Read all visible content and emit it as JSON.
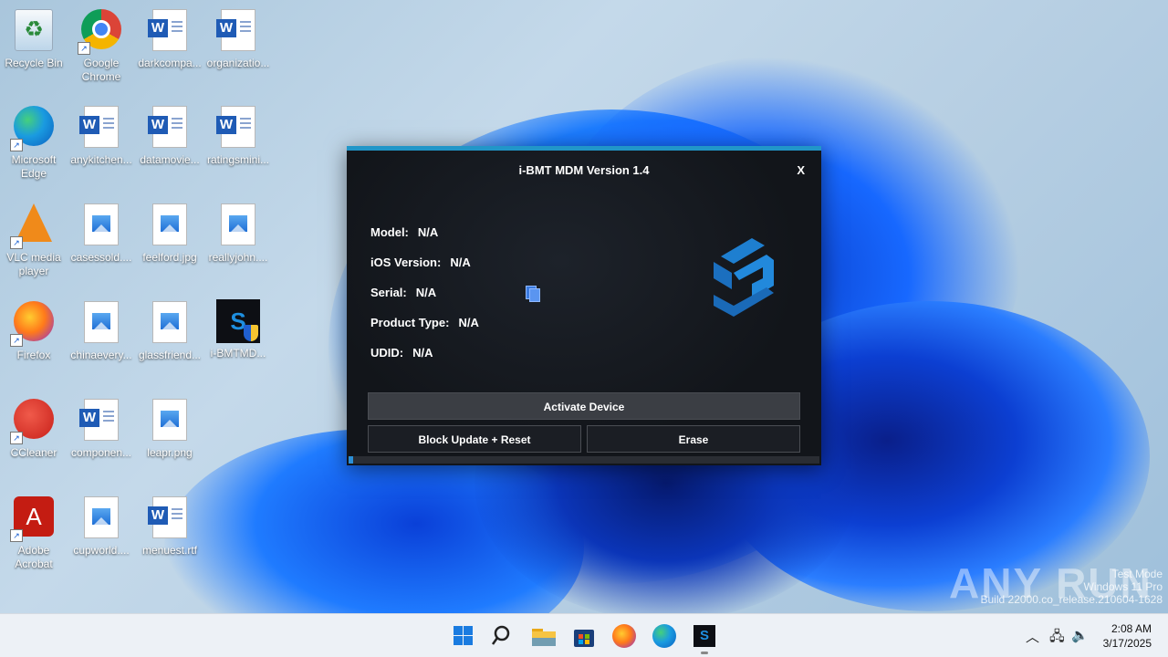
{
  "desktop": {
    "icons": [
      {
        "label": "Recycle Bin"
      },
      {
        "label": "Google Chrome"
      },
      {
        "label": "darkcompa..."
      },
      {
        "label": "organizatio..."
      },
      {
        "label": "Microsoft Edge"
      },
      {
        "label": "anykitchen..."
      },
      {
        "label": "datamovie..."
      },
      {
        "label": "ratingsmini..."
      },
      {
        "label": "VLC media player"
      },
      {
        "label": "casessold...."
      },
      {
        "label": "feelford.jpg"
      },
      {
        "label": "reallyjohn...."
      },
      {
        "label": "Firefox"
      },
      {
        "label": "chinaevery..."
      },
      {
        "label": "glassfriend..."
      },
      {
        "label": "i-BMTMD..."
      },
      {
        "label": "CCleaner"
      },
      {
        "label": "componen..."
      },
      {
        "label": "leapr.png"
      },
      {
        "label": "Adobe Acrobat"
      },
      {
        "label": "cupworld...."
      },
      {
        "label": "menuest.rtf"
      }
    ]
  },
  "app": {
    "title": "i-BMT MDM Version 1.4",
    "close_label": "X",
    "fields": [
      {
        "label": "Model:",
        "value": "N/A"
      },
      {
        "label": "iOS Version:",
        "value": "N/A"
      },
      {
        "label": "Serial:",
        "value": "N/A"
      },
      {
        "label": "Product Type:",
        "value": "N/A"
      },
      {
        "label": "UDID:",
        "value": "N/A"
      }
    ],
    "buttons": {
      "activate": "Activate Device",
      "block": "Block Update + Reset",
      "erase": "Erase"
    },
    "progress_percent": 1,
    "accent_color": "#2196c8"
  },
  "watermark": {
    "brand": "ANY RUN",
    "line1": "Test Mode",
    "line2": "Windows 11 Pro",
    "line3": "Build 22000.co_release.210604-1628"
  },
  "taskbar": {
    "time": "2:08 AM",
    "date": "3/17/2025"
  }
}
